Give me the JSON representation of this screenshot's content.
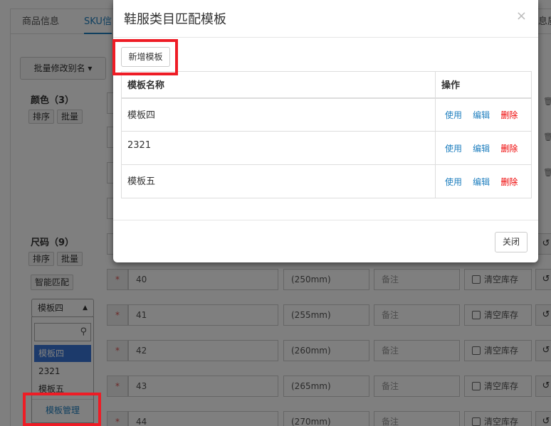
{
  "background": {
    "tabs": [
      "商品信息",
      "SKU信",
      "息质"
    ],
    "bulk_alias_button": "批量修改别名",
    "color_section": {
      "label": "颜色（3）",
      "sort_label": "排序",
      "bulk_label": "批量"
    },
    "size_section": {
      "label": "尺码（9）",
      "sort_label": "排序",
      "bulk_label": "批量",
      "smart_match_label": "智能匹配"
    },
    "template_select": {
      "value": "模板四",
      "options": [
        "模板四",
        "2321",
        "模板五"
      ],
      "manage_label": "模板管理"
    },
    "size_rows": [
      {
        "star": "*",
        "size": "40",
        "mm": "(250mm)",
        "note_placeholder": "备注",
        "clear_label": "清空库存"
      },
      {
        "star": "*",
        "size": "41",
        "mm": "(255mm)",
        "note_placeholder": "备注",
        "clear_label": "清空库存"
      },
      {
        "star": "*",
        "size": "42",
        "mm": "(260mm)",
        "note_placeholder": "备注",
        "clear_label": "清空库存"
      },
      {
        "star": "*",
        "size": "43",
        "mm": "(265mm)",
        "note_placeholder": "备注",
        "clear_label": "清空库存"
      },
      {
        "star": "*",
        "size": "44",
        "mm": "(270mm)",
        "note_placeholder": "备注",
        "clear_label": "清空库存"
      }
    ]
  },
  "modal": {
    "title": "鞋服类目匹配模板",
    "close_glyph": "×",
    "add_button": "新增模板",
    "table": {
      "headers": [
        "模板名称",
        "操作"
      ],
      "rows": [
        {
          "name": "模板四",
          "use": "使用",
          "edit": "编辑",
          "delete": "删除"
        },
        {
          "name": "2321",
          "use": "使用",
          "edit": "编辑",
          "delete": "删除"
        },
        {
          "name": "模板五",
          "use": "使用",
          "edit": "编辑",
          "delete": "删除"
        }
      ]
    },
    "footer_close": "关闭"
  },
  "colors": {
    "link_blue": "#1f7fbf",
    "delete_red": "#ee0000",
    "highlight_red": "#ee1c25",
    "selected_blue": "#3875d7"
  }
}
